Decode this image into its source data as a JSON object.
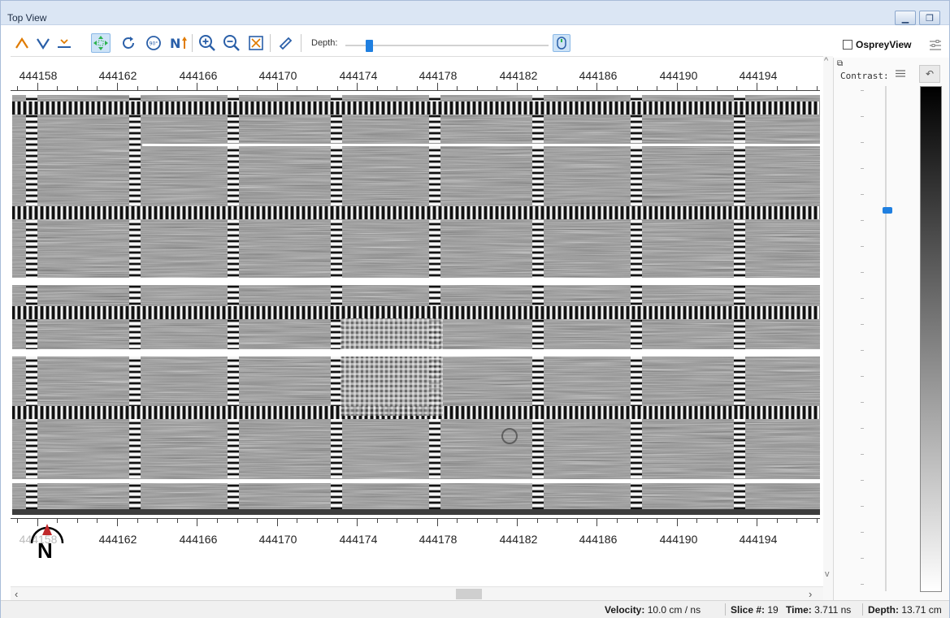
{
  "window": {
    "title": "Top View"
  },
  "toolbar": {
    "icons": [
      "peak-up-icon",
      "peak-down-icon",
      "baseline-icon",
      "pan-icon",
      "rotate-cw-icon",
      "rotate-90-icon",
      "north-up-icon",
      "zoom-in-icon",
      "zoom-out-icon",
      "fit-icon",
      "ruler-icon"
    ],
    "depth_label": "Depth:",
    "depth_value_fraction": 0.1,
    "osprey_label": "OspreyView",
    "osprey_checked": false
  },
  "ruler": {
    "labels": [
      "444158",
      "444162",
      "444166",
      "444170",
      "444174",
      "444178",
      "444182",
      "444186",
      "444190",
      "444194"
    ],
    "bottom_labels": [
      "444158",
      "444162",
      "444166",
      "444170",
      "444174",
      "444178",
      "444182",
      "444186",
      "444190",
      "444194"
    ]
  },
  "compass": {
    "label": "N"
  },
  "contrast": {
    "label": "Contrast:",
    "level_fraction": 0.24
  },
  "status": {
    "velocity_label": "Velocity:",
    "velocity_value": "10.0 cm / ns",
    "slice_label": "Slice #:",
    "slice_value": "19",
    "time_label": "Time:",
    "time_value": "3.711 ns",
    "depth_label": "Depth:",
    "depth_value": "13.71 cm"
  },
  "colors": {
    "accent": "#1f7fe0",
    "titlebar": "#dbe6f4",
    "orange_icon": "#e07b00",
    "blue_icon": "#2a5fa8",
    "green_icon": "#2bb24c"
  }
}
